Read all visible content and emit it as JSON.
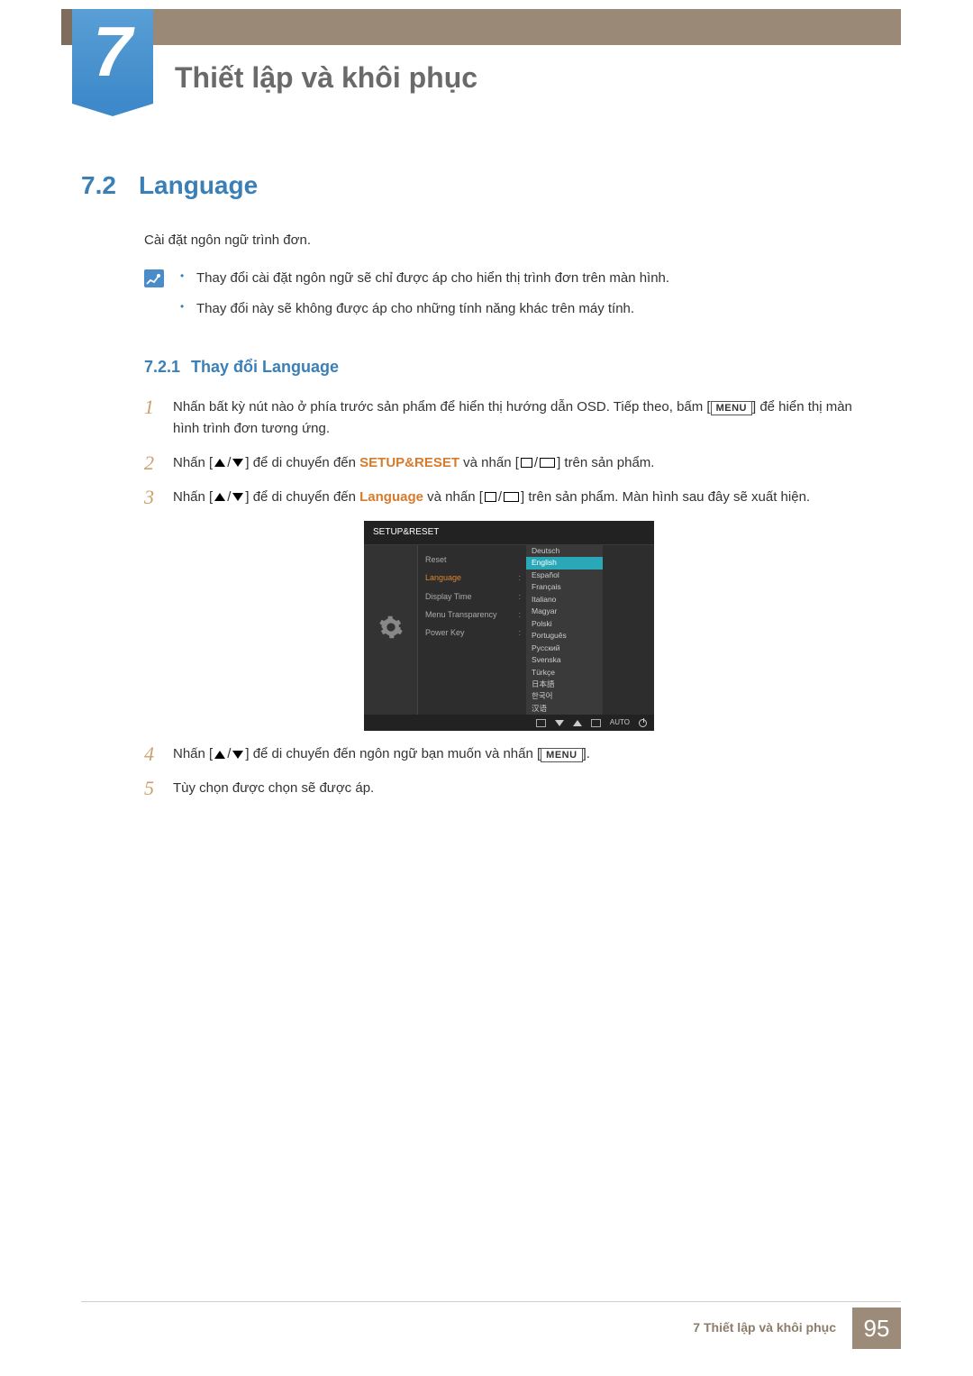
{
  "chapter": {
    "number": "7",
    "title": "Thiết lập và khôi phục"
  },
  "section": {
    "number": "7.2",
    "title": "Language"
  },
  "intro": "Cài đặt ngôn ngữ trình đơn.",
  "notes": [
    "Thay đổi cài đặt ngôn ngữ sẽ chỉ được áp cho hiển thị trình đơn trên màn hình.",
    "Thay đổi này sẽ không được áp cho những tính năng khác trên máy tính."
  ],
  "subsection": {
    "number": "7.2.1",
    "title": "Thay đổi Language"
  },
  "steps": {
    "s1": {
      "num": "1",
      "pre": "Nhấn bất kỳ nút nào ở phía trước sản phẩm để hiển thị hướng dẫn OSD. Tiếp theo, bấm [",
      "menu": "MENU",
      "post": "] để hiển thị màn hình trình đơn tương ứng."
    },
    "s2": {
      "num": "2",
      "pre": "Nhấn [",
      "mid": "] để di chuyển đến ",
      "orange": "SETUP&RESET",
      "mid2": " và nhấn [",
      "post": "] trên sản phẩm."
    },
    "s3": {
      "num": "3",
      "pre": "Nhấn [",
      "mid": "] để di chuyển đến ",
      "orange": "Language",
      "mid2": " và nhấn [",
      "post": "] trên sản phẩm. Màn hình sau đây sẽ xuất hiện."
    },
    "s4": {
      "num": "4",
      "pre": "Nhấn [",
      "mid": "] để di chuyển đến ngôn ngữ bạn muốn và nhấn [",
      "menu": "MENU",
      "post": "]."
    },
    "s5": {
      "num": "5",
      "text": "Tùy chọn được chọn sẽ được áp."
    }
  },
  "osd": {
    "title": "SETUP&RESET",
    "left_menu": [
      {
        "label": "Reset",
        "selected": false
      },
      {
        "label": "Language",
        "selected": true
      },
      {
        "label": "Display Time",
        "selected": false
      },
      {
        "label": "Menu Transparency",
        "selected": false
      },
      {
        "label": "Power Key",
        "selected": false
      }
    ],
    "right_menu": [
      {
        "label": "Deutsch",
        "highlight": false
      },
      {
        "label": "English",
        "highlight": true
      },
      {
        "label": "Español",
        "highlight": false
      },
      {
        "label": "Français",
        "highlight": false
      },
      {
        "label": "Italiano",
        "highlight": false
      },
      {
        "label": "Magyar",
        "highlight": false
      },
      {
        "label": "Polski",
        "highlight": false
      },
      {
        "label": "Português",
        "highlight": false
      },
      {
        "label": "Русский",
        "highlight": false
      },
      {
        "label": "Svenska",
        "highlight": false
      },
      {
        "label": "Türkçe",
        "highlight": false
      },
      {
        "label": "日本語",
        "highlight": false
      },
      {
        "label": "한국어",
        "highlight": false
      },
      {
        "label": "汉语",
        "highlight": false
      }
    ],
    "footer": {
      "auto": "AUTO"
    }
  },
  "footer": {
    "text": "7 Thiết lập và khôi phục",
    "page": "95"
  }
}
